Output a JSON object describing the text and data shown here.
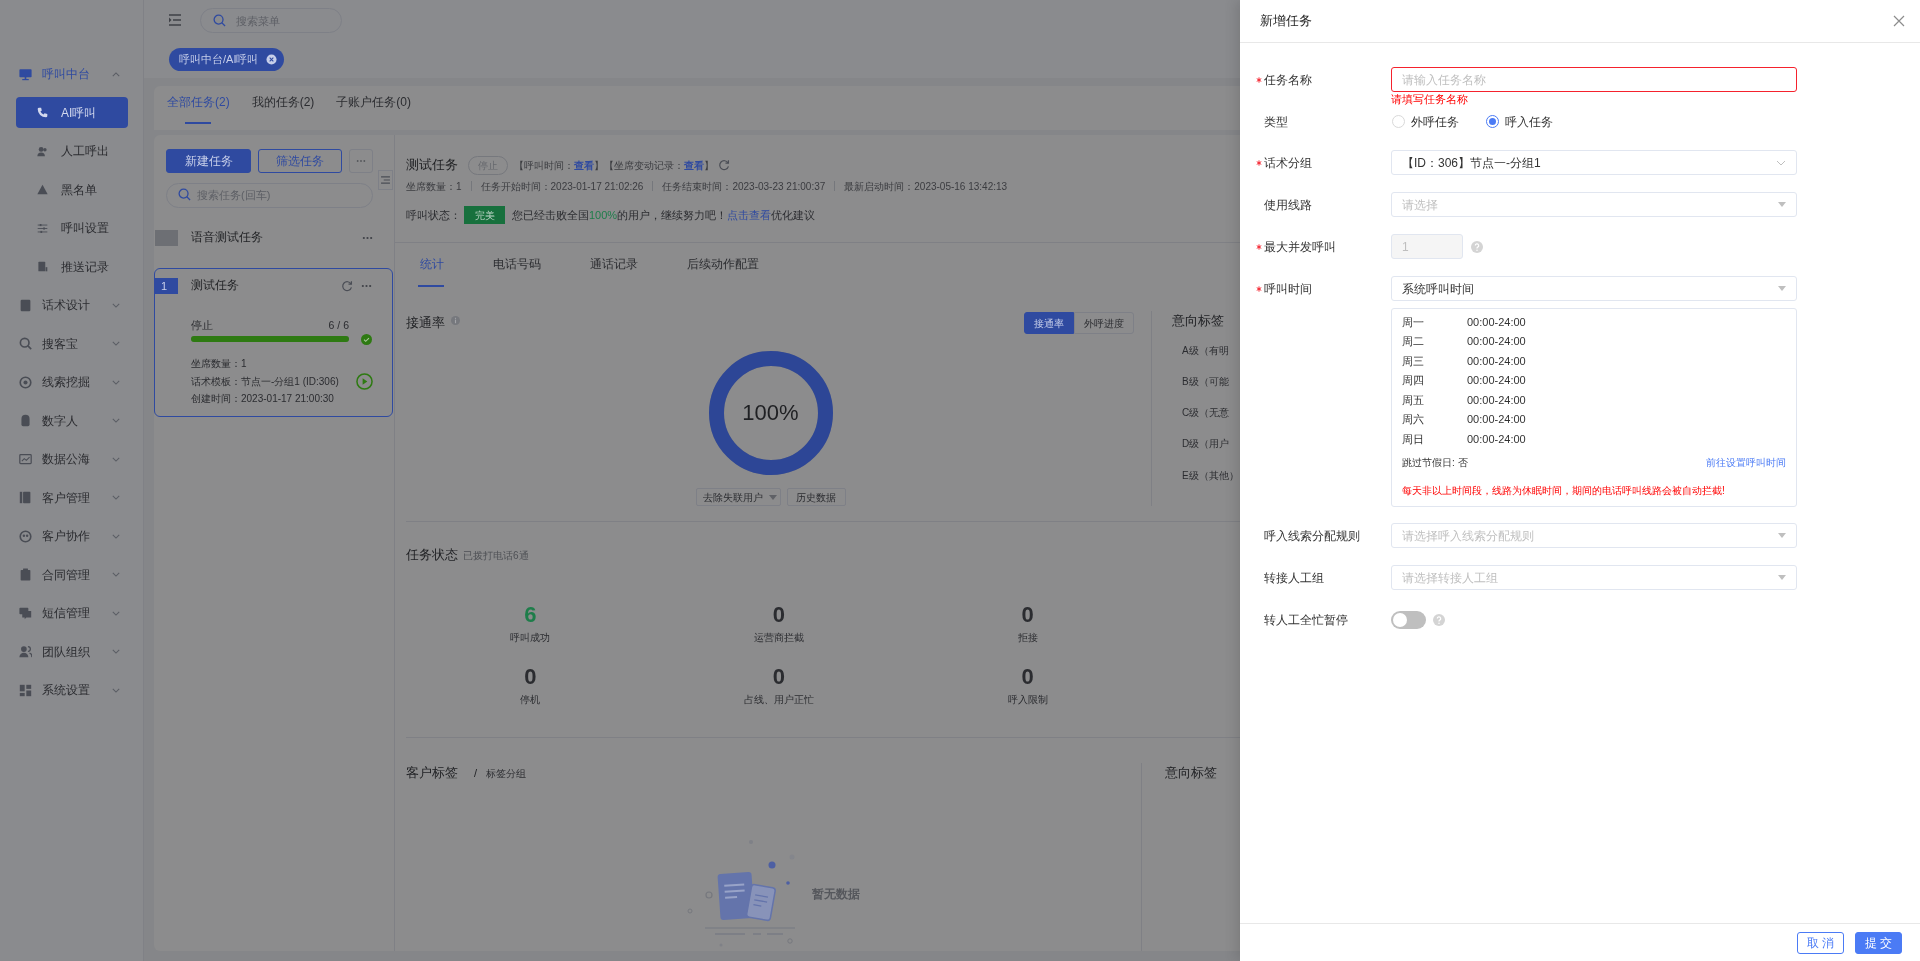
{
  "top_bar": {
    "search": {
      "placeholder": "搜索菜单"
    }
  },
  "sidebar": {
    "items": [
      {
        "label": "呼叫中台",
        "expanded": true,
        "children": [
          {
            "label": "AI呼叫",
            "selected": true
          },
          {
            "label": "人工呼出",
            "selected": false
          },
          {
            "label": "黑名单",
            "selected": false
          },
          {
            "label": "呼叫设置",
            "selected": false
          },
          {
            "label": "推送记录",
            "selected": false
          }
        ]
      },
      {
        "label": "话术设计",
        "expanded": false
      },
      {
        "label": "搜客宝",
        "expanded": false
      },
      {
        "label": "线索挖掘",
        "expanded": false
      },
      {
        "label": "数字人",
        "expanded": false
      },
      {
        "label": "数据公海",
        "expanded": false
      },
      {
        "label": "客户管理",
        "expanded": false
      },
      {
        "label": "客户协作",
        "expanded": false
      },
      {
        "label": "合同管理",
        "expanded": false
      },
      {
        "label": "短信管理",
        "expanded": false
      },
      {
        "label": "团队组织",
        "expanded": false
      },
      {
        "label": "系统设置",
        "expanded": false
      }
    ]
  },
  "tags": [
    {
      "label": "呼叫中台/AI呼叫",
      "selected": true
    }
  ],
  "task_tabs": [
    {
      "label": "全部任务(2)",
      "selected": true
    },
    {
      "label": "我的任务(2)",
      "selected": false
    },
    {
      "label": "子账户任务(0)",
      "selected": false
    }
  ],
  "task_panel": {
    "buttons": [
      {
        "label": "新建任务",
        "kind": "primary"
      },
      {
        "label": "筛选任务",
        "kind": "outline"
      }
    ],
    "search": {
      "placeholder": "搜索任务(回车)"
    },
    "tasks": [
      {
        "name": "语音测试任务",
        "selected": false
      },
      {
        "number": "1",
        "name": "测试任务",
        "selected": true,
        "status": "停止",
        "reading": "6 / 6",
        "level": 1,
        "complete": true,
        "details": [
          "坐席数量：1",
          "话术模板：节点一-分组1 (ID:306)",
          "创建时间：2023-01-17 21:00:30"
        ]
      }
    ]
  },
  "task_detail": {
    "title": "测试任务",
    "status": "停止",
    "notes": [
      {
        "before": "【呼叫时间：",
        "link": "查看",
        "after": "】"
      },
      {
        "before": "【坐席变动记录：",
        "link": "查看",
        "after": "】"
      }
    ],
    "meta": [
      "坐席数量：1",
      "任务开始时间：2023-01-17 21:02:26",
      "任务结束时间：2023-03-23 21:00:37",
      "最新启动时间：2023-05-16 13:42:13"
    ],
    "call_status": {
      "label": "呼叫状态：",
      "badge": "完美",
      "message": "您已经击败全国**100%**的用户，继续努力吧！",
      "link": "点击查看",
      "after": "优化建议"
    },
    "tabs": [
      {
        "label": "统计",
        "selected": true
      },
      {
        "label": "电话号码",
        "selected": false
      },
      {
        "label": "通话记录",
        "selected": false
      },
      {
        "label": "后续动作配置",
        "selected": false
      }
    ],
    "connect_rate": {
      "title": "接通率",
      "views": [
        {
          "label": "接通率",
          "selected": true
        },
        {
          "label": "外呼进度",
          "selected": false
        }
      ],
      "ring": {
        "level": 1,
        "reading": "100%"
      },
      "filter": "去除失联用户",
      "history_button": "历史数据"
    },
    "intent_tags": {
      "title": "意向标签",
      "items": [
        "A级（有明",
        "B级（可能",
        "C级（无意",
        "D级（用户",
        "E级（其他）"
      ]
    },
    "task_status": {
      "title": "任务状态",
      "subtitle": "已拨打电话6通",
      "stats": [
        {
          "value": "6",
          "label": "呼叫成功",
          "highlighted": true
        },
        {
          "value": "0",
          "label": "运营商拦截",
          "highlighted": false
        },
        {
          "value": "0",
          "label": "拒接",
          "highlighted": false
        },
        {
          "value": "0",
          "label": "停机",
          "highlighted": false
        },
        {
          "value": "0",
          "label": "占线、用户正忙",
          "highlighted": false
        },
        {
          "value": "0",
          "label": "呼入限制",
          "highlighted": false
        }
      ]
    },
    "customer_tags": {
      "title": "客户标签",
      "separator": "/",
      "subtitle": "标签分组",
      "empty_text": "暂无数据"
    },
    "intent_tags_panel": {
      "title": "意向标签"
    }
  },
  "dialog": {
    "title": "新增任务",
    "fields": [
      {
        "kind": "text",
        "label": "任务名称",
        "required": true,
        "placeholder": "请输入任务名称",
        "error": "请填写任务名称"
      },
      {
        "kind": "radio",
        "label": "类型",
        "required": false,
        "options": [
          {
            "label": "外呼任务",
            "selected": false
          },
          {
            "label": "呼入任务",
            "selected": true
          }
        ]
      },
      {
        "kind": "treeselect",
        "label": "话术分组",
        "required": true,
        "value": "【ID：306】节点一-分组1"
      },
      {
        "kind": "select",
        "label": "使用线路",
        "required": false,
        "placeholder": "请选择"
      },
      {
        "kind": "number",
        "label": "最大并发呼叫",
        "required": true,
        "value": "1",
        "disabled": true,
        "help": true
      },
      {
        "kind": "schedule",
        "label": "呼叫时间",
        "required": true,
        "value": "系统呼叫时间",
        "days": [
          {
            "day": "周一",
            "hours": "00:00-24:00"
          },
          {
            "day": "周二",
            "hours": "00:00-24:00"
          },
          {
            "day": "周三",
            "hours": "00:00-24:00"
          },
          {
            "day": "周四",
            "hours": "00:00-24:00"
          },
          {
            "day": "周五",
            "hours": "00:00-24:00"
          },
          {
            "day": "周六",
            "hours": "00:00-24:00"
          },
          {
            "day": "周日",
            "hours": "00:00-24:00"
          }
        ],
        "holiday_note": "跳过节假日: 否",
        "link": "前往设置呼叫时间",
        "warning": "每天非以上时间段，线路为休眠时间，期间的电话呼叫线路会被自动拦截!"
      },
      {
        "kind": "select",
        "label": "呼入线索分配规则",
        "required": false,
        "placeholder": "请选择呼入线索分配规则"
      },
      {
        "kind": "select",
        "label": "转接人工组",
        "required": false,
        "placeholder": "请选择转接人工组"
      },
      {
        "kind": "switch",
        "label": "转人工全忙暂停",
        "required": false,
        "on": false,
        "help": true
      }
    ],
    "buttons": [
      {
        "label": "取 消",
        "kind": "secondary"
      },
      {
        "label": "提 交",
        "kind": "primary"
      }
    ]
  }
}
